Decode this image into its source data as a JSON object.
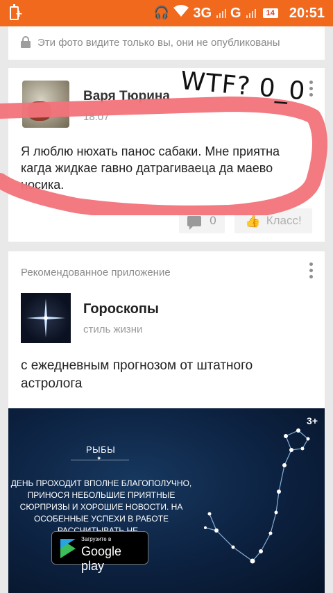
{
  "status_bar": {
    "network_3g": "3G",
    "network_g": "G",
    "notification_count": "14",
    "time": "20:51",
    "icons": [
      "battery-charging-icon",
      "headset-icon",
      "wifi-icon",
      "signal-icon"
    ],
    "color": "#f0691d"
  },
  "privacy_notice": {
    "text": "Эти фото видите только вы, они не опубликованы",
    "icon": "lock-icon"
  },
  "post": {
    "author": "Варя Тюрина",
    "time": "18:07",
    "text": "Я люблю нюхать панос сабаки. Мне приятна кагда жидкае гавно датрагиваеца да маево носика.",
    "comments_count": "0",
    "like_label": "Класс!",
    "overlay_text": "WTF? 0_0",
    "overlay_color": "#f2737a"
  },
  "recommended": {
    "header": "Рекомендованное приложение",
    "app_name": "Гороскопы",
    "app_category": "стиль жизни",
    "description": "с ежедневным прогнозом от штатного астролога",
    "banner": {
      "age_rating": "3+",
      "sign": "РЫБЫ",
      "horoscope_text": "ДЕНЬ ПРОХОДИТ ВПОЛНЕ БЛАГОПОЛУЧНО, ПРИНОСЯ НЕБОЛЬШИЕ ПРИЯТНЫЕ СЮРПРИЗЫ И ХОРОШИЕ НОВОСТИ. НА ОСОБЕННЫЕ УСПЕХИ В РАБОТЕ РАССЧИТЫВАТЬ НЕ...",
      "store_small": "Загрузите в",
      "store_big": "Google play"
    }
  }
}
